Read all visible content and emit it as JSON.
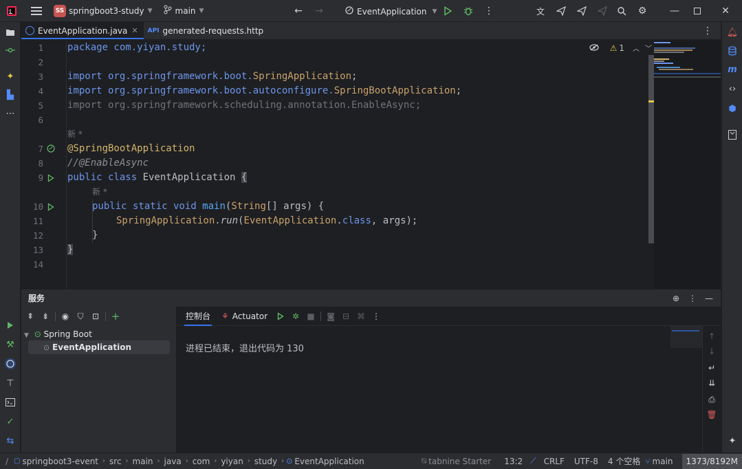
{
  "titlebar": {
    "project_badge": "SS",
    "project_name": "springboot3-study",
    "branch": "main",
    "run_config": "EventApplication"
  },
  "tabs": [
    {
      "label": "EventApplication.java",
      "active": true
    },
    {
      "label": "generated-requests.http",
      "active": false
    }
  ],
  "editor": {
    "inspection_warnings": "1",
    "hint_new": "新 *",
    "lines": {
      "l1": "package com.yiyan.study;",
      "l3_kw": "import",
      "l3_pkg": " org.springframework.boot.",
      "l3_cls": "SpringApplication",
      "l3_end": ";",
      "l4_kw": "import",
      "l4_pkg": " org.springframework.boot.autoconfigure.",
      "l4_cls": "SpringBootApplication",
      "l4_end": ";",
      "l5": "import org.springframework.scheduling.annotation.EnableAsync;",
      "l7": "@SpringBootApplication",
      "l8": "//@EnableAsync",
      "l9_kw": "public class ",
      "l9_name": "EventApplication",
      "l9_brace": "{",
      "l10_kw": "public static void ",
      "l10_fn": "main",
      "l10_p1": "(",
      "l10_type": "String",
      "l10_p2": "[] args) {",
      "l11_cls": "SpringApplication",
      "l11_dot": ".",
      "l11_run": "run",
      "l11_p1": "(",
      "l11_cls2": "EventApplication",
      "l11_dot2": ".",
      "l11_kw": "class",
      "l11_end": ", args);",
      "l12": "}",
      "l13": "}"
    },
    "line_numbers": [
      "1",
      "2",
      "3",
      "4",
      "5",
      "6",
      "7",
      "8",
      "9",
      "10",
      "11",
      "12",
      "13",
      "14"
    ]
  },
  "services": {
    "title": "服务",
    "tree": [
      {
        "label": "Spring Boot",
        "expanded": true
      },
      {
        "label": "EventApplication",
        "selected": true
      }
    ],
    "tabs": [
      {
        "label": "控制台",
        "active": true
      },
      {
        "label": "Actuator",
        "active": false
      }
    ],
    "console_output": "进程已结束，退出代码为 130"
  },
  "statusbar": {
    "breadcrumbs": [
      "springboot3-event",
      "src",
      "main",
      "java",
      "com",
      "yiyan",
      "study",
      "EventApplication"
    ],
    "plugin": "tabnine Starter",
    "position": "13:2",
    "line_ending": "CRLF",
    "encoding": "UTF-8",
    "indent": "4 个空格",
    "branch": "main",
    "memory": "1373/8192M"
  },
  "colors": {
    "accent": "#3574f0",
    "run_green": "#5fb865",
    "project_badge": "#c75450",
    "delete_red": "#db5c5c"
  }
}
